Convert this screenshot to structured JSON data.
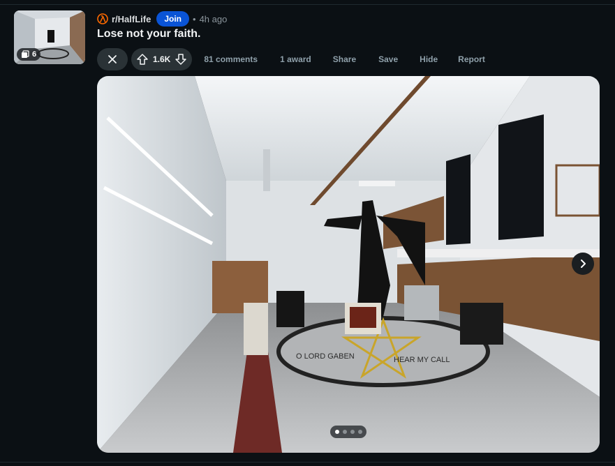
{
  "post": {
    "subreddit": "r/HalfLife",
    "join_label": "Join",
    "separator": "•",
    "age": "4h ago",
    "title": "Lose not your faith.",
    "gallery_count": "6",
    "score": "1.6K",
    "actions": {
      "comments": "81 comments",
      "award": "1 award",
      "share": "Share",
      "save": "Save",
      "hide": "Hide",
      "report": "Report"
    }
  },
  "gallery": {
    "floor_text_left": "O LORD GABEN",
    "floor_text_right": "HEAR MY CALL",
    "slides_visible": 4,
    "active_slide": 1
  },
  "colors": {
    "background": "#0b1014",
    "join": "#0a54d6",
    "subreddit_icon": "#ff6a00",
    "action_text": "#8fa0aa"
  },
  "icons": [
    "half-life-lambda-icon",
    "gallery-icon",
    "close-icon",
    "upvote-icon",
    "downvote-icon",
    "chevron-right-icon"
  ]
}
